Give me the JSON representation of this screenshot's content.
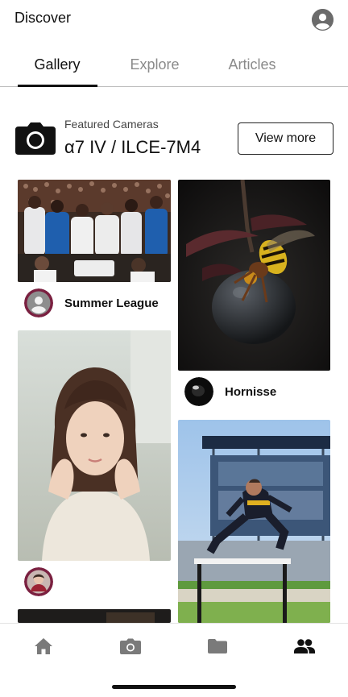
{
  "header": {
    "title": "Discover",
    "profile_icon": "account-circle-icon"
  },
  "tabs": [
    {
      "label": "Gallery",
      "active": true
    },
    {
      "label": "Explore",
      "active": false
    },
    {
      "label": "Articles",
      "active": false
    }
  ],
  "featured": {
    "icon": "camera-icon",
    "label": "Featured Cameras",
    "model": "α7 IV / ILCE-7M4",
    "button_label": "View more"
  },
  "gallery": {
    "left": [
      {
        "photo": "basketball-team-huddle-photo",
        "author": "Summer League"
      },
      {
        "photo": "woman-portrait-photo",
        "author": ""
      },
      {
        "photo": "dark-partial-photo",
        "author": ""
      }
    ],
    "right": [
      {
        "photo": "hornet-macro-photo",
        "author": "Hornisse"
      },
      {
        "photo": "hurdle-jumper-photo",
        "author": ""
      }
    ]
  },
  "bottom_nav": [
    {
      "icon": "home-icon",
      "active": false
    },
    {
      "icon": "camera-icon",
      "active": false
    },
    {
      "icon": "folder-icon",
      "active": false
    },
    {
      "icon": "people-icon",
      "active": true
    }
  ],
  "colors": {
    "active": "#111111",
    "inactive": "#8a8a8a",
    "nav_inactive": "#7a7a7a"
  }
}
